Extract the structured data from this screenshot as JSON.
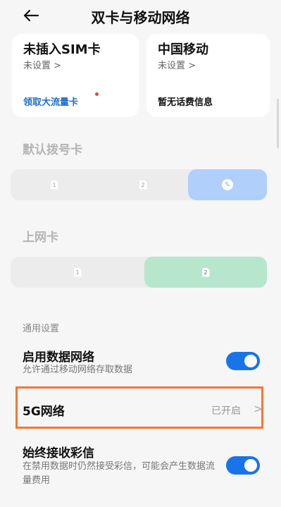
{
  "header": {
    "title": "双卡与移动网络"
  },
  "sim_cards": [
    {
      "name": "未插入SIM卡",
      "status": "未设置 >",
      "footer_link": "领取大流量卡"
    },
    {
      "name": "中国移动",
      "status": "未设置 >",
      "footer_info": "暂无话费信息"
    }
  ],
  "default_dial": {
    "title": "默认拨号卡",
    "options": [
      {
        "label": "1",
        "selected": false
      },
      {
        "label": "2",
        "selected": false
      },
      {
        "label": "✎",
        "selected": true
      }
    ]
  },
  "data_card": {
    "title": "上网卡",
    "options": [
      {
        "label": "1",
        "selected": false
      },
      {
        "label": "2",
        "selected": true
      }
    ]
  },
  "general": {
    "group_label": "通用设置",
    "mobile_data": {
      "title": "启用数据网络",
      "subtitle": "允许通过移动网络存取数据",
      "enabled": true
    },
    "network_5g": {
      "title": "5G网络",
      "value": "已开启",
      "chevron": ">"
    },
    "mms": {
      "title": "始终接收彩信",
      "subtitle": "在禁用数据时仍然接受彩信，可能会产生数据流量费用",
      "enabled": true
    }
  },
  "colors": {
    "accent": "#1874e8",
    "highlight_box": "#f07838",
    "link": "#1f6fc8",
    "dot": "#e8453c"
  }
}
